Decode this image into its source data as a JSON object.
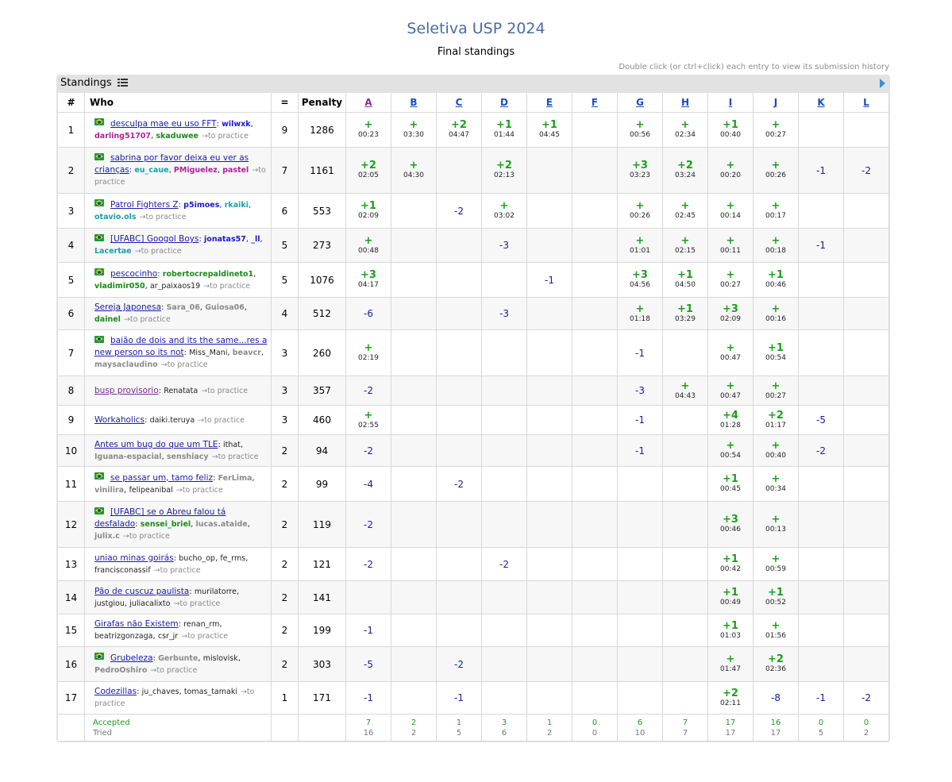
{
  "page": {
    "title": "Seletiva USP 2024",
    "subtitle": "Final standings",
    "hint": "Double click (or ctrl+click) each entry to view its submission history",
    "panel_title": "Standings"
  },
  "colors": {
    "solved": "#1aa01a",
    "failed": "#1a1aa8",
    "title": "#4a6aa8"
  },
  "icons": {
    "flag": "brazil-flag-icon",
    "list": "list-icon",
    "collapse": "play-arrow-icon"
  },
  "headers": {
    "rank": "#",
    "who": "Who",
    "solved": "=",
    "penalty": "Penalty"
  },
  "problems": [
    "A",
    "B",
    "C",
    "D",
    "E",
    "F",
    "G",
    "H",
    "I",
    "J",
    "K",
    "L"
  ],
  "visited_problems": [
    "A"
  ],
  "rows": [
    {
      "rank": "1",
      "flag": true,
      "team": "desculpa mae eu uso FFT",
      "visited": false,
      "members": [
        {
          "n": "wilwxk",
          "c": "#1a1ad0"
        },
        {
          "n": "darling51707",
          "c": "#b0229a"
        },
        {
          "n": "skaduwee",
          "c": "#1a8a1a"
        }
      ],
      "practice": "→to practice",
      "solved": "9",
      "penalty": "1286",
      "cells": [
        [
          "+",
          "00:23"
        ],
        [
          "+",
          "03:30"
        ],
        [
          "+2",
          "04:47"
        ],
        [
          "+1",
          "01:44"
        ],
        [
          "+1",
          "04:45"
        ],
        null,
        [
          "+",
          "00:56"
        ],
        [
          "+",
          "02:34"
        ],
        [
          "+1",
          "00:40"
        ],
        [
          "+",
          "00:27"
        ],
        null,
        null
      ]
    },
    {
      "rank": "2",
      "flag": true,
      "team": "sabrina por favor deixa eu ver as crianças",
      "visited": false,
      "members": [
        {
          "n": "eu_caue",
          "c": "#18a0a8"
        },
        {
          "n": "PMiguelez",
          "c": "#b0229a"
        },
        {
          "n": "pastel",
          "c": "#b0229a"
        }
      ],
      "practice": "→to practice",
      "solved": "7",
      "penalty": "1161",
      "cells": [
        [
          "+2",
          "02:05"
        ],
        [
          "+",
          "04:30"
        ],
        null,
        [
          "+2",
          "02:13"
        ],
        null,
        null,
        [
          "+3",
          "03:23"
        ],
        [
          "+2",
          "03:24"
        ],
        [
          "+",
          "00:20"
        ],
        [
          "+",
          "00:26"
        ],
        [
          "-1",
          null
        ],
        [
          "-2",
          null
        ]
      ]
    },
    {
      "rank": "3",
      "flag": true,
      "team": "Patrol Fighters Z",
      "visited": false,
      "members": [
        {
          "n": "p5imoes",
          "c": "#1a1ad0"
        },
        {
          "n": "rkaiki",
          "c": "#18a0a8"
        },
        {
          "n": "otavio.ols",
          "c": "#18a0a8"
        }
      ],
      "practice": "→to practice",
      "solved": "6",
      "penalty": "553",
      "cells": [
        [
          "+1",
          "02:09"
        ],
        null,
        [
          "-2",
          null
        ],
        [
          "+",
          "03:02"
        ],
        null,
        null,
        [
          "+",
          "00:26"
        ],
        [
          "+",
          "02:45"
        ],
        [
          "+",
          "00:14"
        ],
        [
          "+",
          "00:17"
        ],
        null,
        null
      ]
    },
    {
      "rank": "4",
      "flag": true,
      "team": "[UFABC] Googol Boys",
      "visited": false,
      "members": [
        {
          "n": "jonatas57",
          "c": "#1a1ad0"
        },
        {
          "n": "_ll",
          "c": "#1a1ad0"
        },
        {
          "n": "Lacertae",
          "c": "#18a0a8"
        }
      ],
      "practice": "→to practice",
      "solved": "5",
      "penalty": "273",
      "cells": [
        [
          "+",
          "00:48"
        ],
        null,
        null,
        [
          "-3",
          null
        ],
        null,
        null,
        [
          "+",
          "01:01"
        ],
        [
          "+",
          "02:15"
        ],
        [
          "+",
          "00:11"
        ],
        [
          "+",
          "00:18"
        ],
        [
          "-1",
          null
        ],
        null
      ]
    },
    {
      "rank": "5",
      "flag": true,
      "team": "pescocinho",
      "visited": false,
      "members": [
        {
          "n": "robertocrepaldineto1",
          "c": "#1a8a1a"
        },
        {
          "n": "vladimir050",
          "c": "#1a8a1a"
        },
        {
          "n": "ar_paixaos19",
          "c": "#222"
        }
      ],
      "practice": "→to practice",
      "solved": "5",
      "penalty": "1076",
      "cells": [
        [
          "+3",
          "04:17"
        ],
        null,
        null,
        null,
        [
          "-1",
          null
        ],
        null,
        [
          "+3",
          "04:56"
        ],
        [
          "+1",
          "04:50"
        ],
        [
          "+",
          "00:27"
        ],
        [
          "+1",
          "00:46"
        ],
        null,
        null
      ]
    },
    {
      "rank": "6",
      "flag": false,
      "team": "Sereja Japonesa",
      "visited": false,
      "members": [
        {
          "n": "Sara_06",
          "c": "#8a8a8a"
        },
        {
          "n": "Guiosa06",
          "c": "#8a8a8a"
        },
        {
          "n": "dainel",
          "c": "#1a8a1a"
        }
      ],
      "practice": "→to practice",
      "solved": "4",
      "penalty": "512",
      "cells": [
        [
          "-6",
          null
        ],
        null,
        null,
        [
          "-3",
          null
        ],
        null,
        null,
        [
          "+",
          "01:18"
        ],
        [
          "+1",
          "03:29"
        ],
        [
          "+3",
          "02:09"
        ],
        [
          "+",
          "00:16"
        ],
        null,
        null
      ]
    },
    {
      "rank": "7",
      "flag": true,
      "team": "baião de dois and its the same...res a new person so its not",
      "visited": false,
      "members": [
        {
          "n": "Miss_Mani",
          "c": "#222"
        },
        {
          "n": "beavcr",
          "c": "#8a8a8a"
        },
        {
          "n": "maysaclaudino",
          "c": "#8a8a8a"
        }
      ],
      "practice": "→to practice",
      "solved": "3",
      "penalty": "260",
      "cells": [
        [
          "+",
          "02:19"
        ],
        null,
        null,
        null,
        null,
        null,
        [
          "-1",
          null
        ],
        null,
        [
          "+",
          "00:47"
        ],
        [
          "+1",
          "00:54"
        ],
        null,
        null
      ]
    },
    {
      "rank": "8",
      "flag": false,
      "team": "busp provisorio",
      "visited": true,
      "members": [
        {
          "n": "Renatata",
          "c": "#222"
        }
      ],
      "practice": "→to practice",
      "solved": "3",
      "penalty": "357",
      "cells": [
        [
          "-2",
          null
        ],
        null,
        null,
        null,
        null,
        null,
        [
          "-3",
          null
        ],
        [
          "+",
          "04:43"
        ],
        [
          "+",
          "00:47"
        ],
        [
          "+",
          "00:27"
        ],
        null,
        null
      ]
    },
    {
      "rank": "9",
      "flag": false,
      "team": "Workaholics",
      "visited": false,
      "members": [
        {
          "n": "daiki.teruya",
          "c": "#222"
        }
      ],
      "practice": "→to practice",
      "solved": "3",
      "penalty": "460",
      "cells": [
        [
          "+",
          "02:55"
        ],
        null,
        null,
        null,
        null,
        null,
        [
          "-1",
          null
        ],
        null,
        [
          "+4",
          "01:28"
        ],
        [
          "+2",
          "01:17"
        ],
        [
          "-5",
          null
        ],
        null
      ]
    },
    {
      "rank": "10",
      "flag": false,
      "team": "Antes um bug do que um TLE",
      "visited": false,
      "members": [
        {
          "n": "ithat",
          "c": "#222"
        },
        {
          "n": "Iguana-espacial",
          "c": "#8a8a8a"
        },
        {
          "n": "senshiacy",
          "c": "#8a8a8a"
        }
      ],
      "practice": "→to practice",
      "solved": "2",
      "penalty": "94",
      "cells": [
        [
          "-2",
          null
        ],
        null,
        null,
        null,
        null,
        null,
        [
          "-1",
          null
        ],
        null,
        [
          "+",
          "00:54"
        ],
        [
          "+",
          "00:40"
        ],
        [
          "-2",
          null
        ],
        null
      ]
    },
    {
      "rank": "11",
      "flag": true,
      "team": "se passar um, tamo feliz",
      "visited": false,
      "members": [
        {
          "n": "FerLima",
          "c": "#8a8a8a"
        },
        {
          "n": "vinilira",
          "c": "#8a8a8a"
        },
        {
          "n": "felipeanibal",
          "c": "#222"
        }
      ],
      "practice": "→to practice",
      "solved": "2",
      "penalty": "99",
      "cells": [
        [
          "-4",
          null
        ],
        null,
        [
          "-2",
          null
        ],
        null,
        null,
        null,
        null,
        null,
        [
          "+1",
          "00:45"
        ],
        [
          "+",
          "00:34"
        ],
        null,
        null
      ]
    },
    {
      "rank": "12",
      "flag": true,
      "team": "[UFABC] se o Abreu falou tá desfalado",
      "visited": false,
      "members": [
        {
          "n": "sensei_briel",
          "c": "#1a8a1a"
        },
        {
          "n": "lucas.ataide",
          "c": "#8a8a8a"
        },
        {
          "n": "julix.c",
          "c": "#8a8a8a"
        }
      ],
      "practice": "→to practice",
      "solved": "2",
      "penalty": "119",
      "cells": [
        [
          "-2",
          null
        ],
        null,
        null,
        null,
        null,
        null,
        null,
        null,
        [
          "+3",
          "00:46"
        ],
        [
          "+",
          "00:13"
        ],
        null,
        null
      ]
    },
    {
      "rank": "13",
      "flag": false,
      "team": "uniao minas goirás",
      "visited": false,
      "members": [
        {
          "n": "bucho_op",
          "c": "#222"
        },
        {
          "n": "fe_rms",
          "c": "#222"
        },
        {
          "n": "francisconassif",
          "c": "#222"
        }
      ],
      "practice": "→to practice",
      "solved": "2",
      "penalty": "121",
      "cells": [
        [
          "-2",
          null
        ],
        null,
        null,
        [
          "-2",
          null
        ],
        null,
        null,
        null,
        null,
        [
          "+1",
          "00:42"
        ],
        [
          "+",
          "00:59"
        ],
        null,
        null
      ]
    },
    {
      "rank": "14",
      "flag": false,
      "team": "Pão de cuscuz paulista",
      "visited": false,
      "members": [
        {
          "n": "murilatorre",
          "c": "#222"
        },
        {
          "n": "justgiou",
          "c": "#222"
        },
        {
          "n": "juliacalixto",
          "c": "#222"
        }
      ],
      "practice": "→to practice",
      "solved": "2",
      "penalty": "141",
      "cells": [
        null,
        null,
        null,
        null,
        null,
        null,
        null,
        null,
        [
          "+1",
          "00:49"
        ],
        [
          "+1",
          "00:52"
        ],
        null,
        null
      ]
    },
    {
      "rank": "15",
      "flag": false,
      "team": "Girafas não Existem",
      "visited": false,
      "members": [
        {
          "n": "renan_rm",
          "c": "#222"
        },
        {
          "n": "beatrizgonzaga",
          "c": "#222"
        },
        {
          "n": "csr_jr",
          "c": "#222"
        }
      ],
      "practice": "→to practice",
      "solved": "2",
      "penalty": "199",
      "cells": [
        [
          "-1",
          null
        ],
        null,
        null,
        null,
        null,
        null,
        null,
        null,
        [
          "+1",
          "01:03"
        ],
        [
          "+",
          "01:56"
        ],
        null,
        null
      ]
    },
    {
      "rank": "16",
      "flag": true,
      "team": "Grubeleza",
      "visited": false,
      "members": [
        {
          "n": "Gerbunte",
          "c": "#8a8a8a"
        },
        {
          "n": "mislovisk",
          "c": "#222"
        },
        {
          "n": "PedroOshiro",
          "c": "#8a8a8a"
        }
      ],
      "practice": "→to practice",
      "solved": "2",
      "penalty": "303",
      "cells": [
        [
          "-5",
          null
        ],
        null,
        [
          "-2",
          null
        ],
        null,
        null,
        null,
        null,
        null,
        [
          "+",
          "01:47"
        ],
        [
          "+2",
          "02:36"
        ],
        null,
        null
      ]
    },
    {
      "rank": "17",
      "flag": false,
      "team": "Codezillas",
      "visited": false,
      "members": [
        {
          "n": "ju_chaves",
          "c": "#222"
        },
        {
          "n": "tomas_tamaki",
          "c": "#222"
        }
      ],
      "practice": "→to practice",
      "solved": "1",
      "penalty": "171",
      "cells": [
        [
          "-1",
          null
        ],
        null,
        [
          "-1",
          null
        ],
        null,
        null,
        null,
        null,
        null,
        [
          "+2",
          "02:11"
        ],
        [
          "-8",
          null
        ],
        [
          "-1",
          null
        ],
        [
          "-2",
          null
        ]
      ]
    }
  ],
  "footer": {
    "accepted_label": "Accepted",
    "tried_label": "Tried",
    "accepted": [
      "7",
      "2",
      "1",
      "3",
      "1",
      "0",
      "6",
      "7",
      "17",
      "16",
      "0",
      "0"
    ],
    "tried": [
      "16",
      "2",
      "5",
      "6",
      "2",
      "0",
      "10",
      "7",
      "17",
      "17",
      "5",
      "2"
    ]
  }
}
